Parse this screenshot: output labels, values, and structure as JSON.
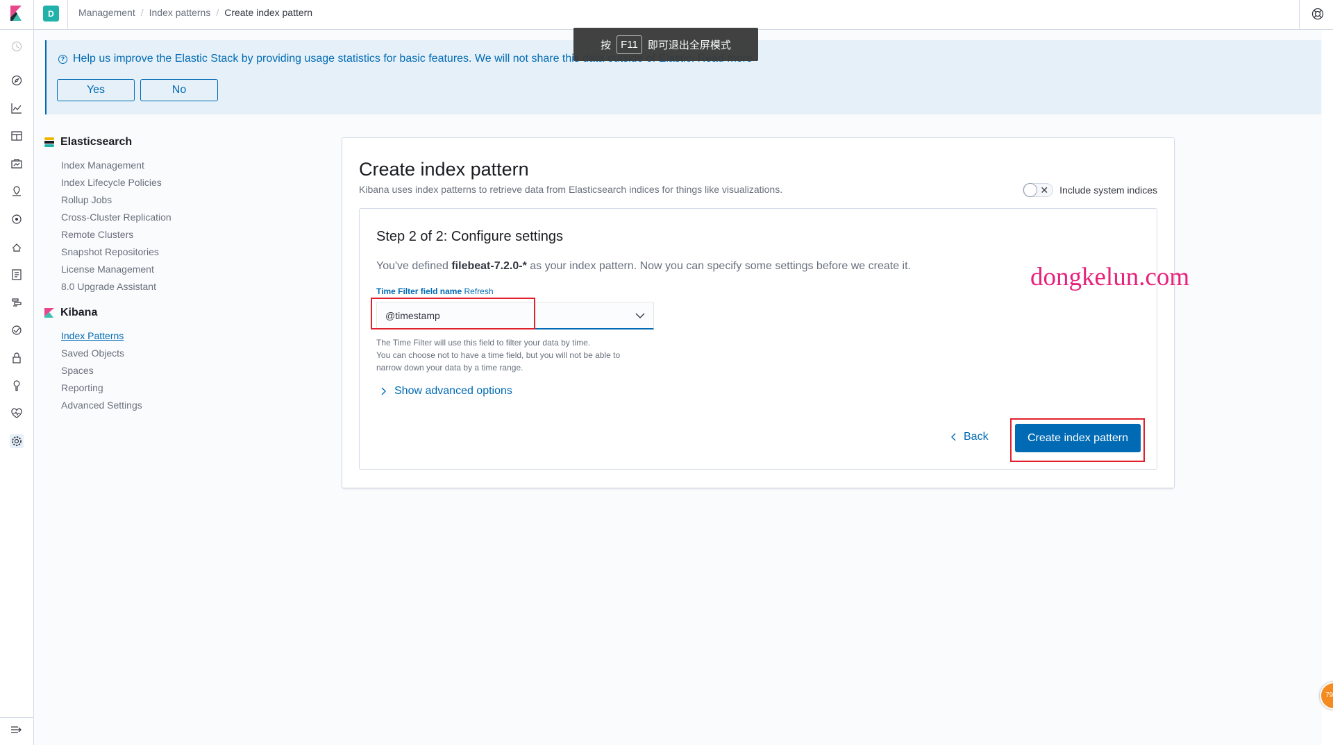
{
  "header": {
    "space_initial": "D",
    "breadcrumbs": [
      "Management",
      "Index patterns",
      "Create index pattern"
    ]
  },
  "toast": {
    "prefix": "按",
    "key": "F11",
    "suffix": "即可退出全屏模式"
  },
  "banner": {
    "message": "Help us improve the Elastic Stack by providing usage statistics for basic features. We will not share this data outside of Elastic. Read more",
    "yes_label": "Yes",
    "no_label": "No"
  },
  "sidenav": {
    "elasticsearch": {
      "title": "Elasticsearch",
      "items": [
        "Index Management",
        "Index Lifecycle Policies",
        "Rollup Jobs",
        "Cross-Cluster Replication",
        "Remote Clusters",
        "Snapshot Repositories",
        "License Management",
        "8.0 Upgrade Assistant"
      ]
    },
    "kibana": {
      "title": "Kibana",
      "items": [
        "Index Patterns",
        "Saved Objects",
        "Spaces",
        "Reporting",
        "Advanced Settings"
      ],
      "active": "Index Patterns"
    }
  },
  "panel": {
    "title": "Create index pattern",
    "subtitle": "Kibana uses index patterns to retrieve data from Elasticsearch indices for things like visualizations.",
    "toggle_label": "Include system indices",
    "step_title": "Step 2 of 2: Configure settings",
    "defined_prefix": "You've defined ",
    "index_pattern": "filebeat-7.2.0-*",
    "defined_suffix": " as your index pattern. Now you can specify some settings before we create it.",
    "field_label": "Time Filter field name",
    "refresh_label": "Refresh",
    "time_field_value": "@timestamp",
    "help_lines": [
      "The Time Filter will use this field to filter your data by time.",
      "You can choose not to have a time field, but you will not be able to",
      "narrow down your data by a time range."
    ],
    "advanced_label": "Show advanced options",
    "back_label": "Back",
    "create_label": "Create index pattern"
  },
  "watermark": "dongkelun.com",
  "badge_text": "79",
  "colors": {
    "primary": "#006bb4",
    "highlight_box": "#e0202b",
    "watermark": "#e8217b"
  }
}
